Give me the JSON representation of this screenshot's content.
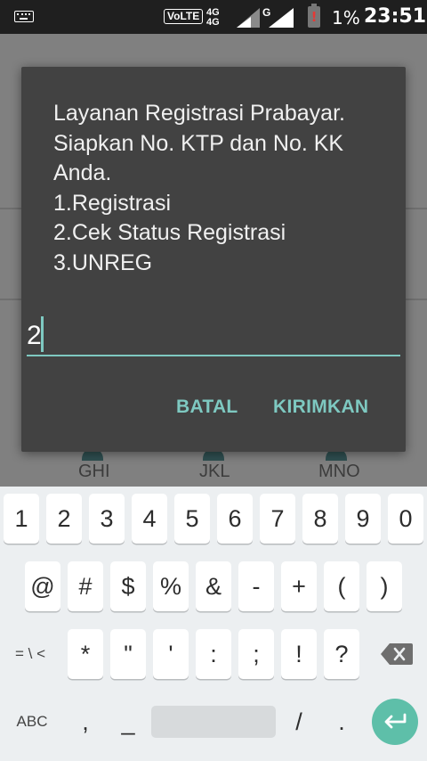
{
  "status_bar": {
    "keyboard_icon": "keyboard-icon",
    "volte": "VoLTE",
    "net_a_top": "4G",
    "net_a_bottom": "4G",
    "net_b": "G",
    "battery_warning": "!",
    "battery_percent": "1%",
    "time": "23:51"
  },
  "dialog": {
    "message_lines": [
      "Layanan Registrasi Prabayar.",
      "Siapkan No. KTP dan No. KK",
      "Anda.",
      "1.Registrasi",
      "2.Cek Status Registrasi",
      "3.UNREG"
    ],
    "input_value": "2",
    "cancel_label": "BATAL",
    "send_label": "KIRIMKAN",
    "accent_color": "#7ec9c1"
  },
  "dialer_background": {
    "keys": [
      "GHI",
      "JKL",
      "MNO"
    ]
  },
  "keyboard": {
    "row1": [
      "1",
      "2",
      "3",
      "4",
      "5",
      "6",
      "7",
      "8",
      "9",
      "0"
    ],
    "row2": [
      "@",
      "#",
      "$",
      "%",
      "&",
      "-",
      "+",
      "(",
      ")"
    ],
    "row3_toggle": "= \\ <",
    "row3": [
      "*",
      "\"",
      "'",
      ":",
      ";",
      "!",
      "?"
    ],
    "row3_backspace_icon": "backspace-icon",
    "row4_abc": "ABC",
    "row4_comma": ",",
    "row4_underscore": "_",
    "row4_slash": "/",
    "row4_period": ".",
    "row4_enter_icon": "enter-icon",
    "enter_color": "#5ebfa9"
  }
}
